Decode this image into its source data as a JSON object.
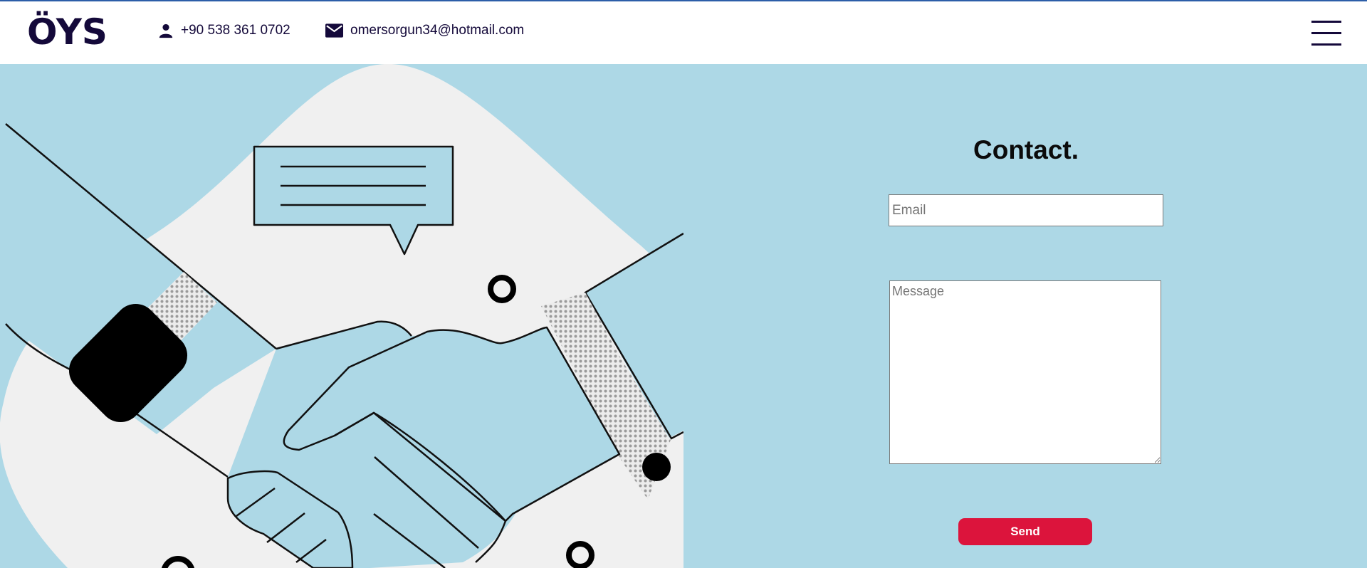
{
  "header": {
    "logo": "ÖYS",
    "phone": "+90 538 361 0702",
    "email": "omersorgun34@hotmail.com"
  },
  "contact": {
    "title": "Contact.",
    "email_placeholder": "Email",
    "message_placeholder": "Message",
    "send_label": "Send"
  },
  "colors": {
    "background": "#add8e6",
    "header_bg": "#ffffff",
    "brand_text": "#14093a",
    "send_button": "#dc143c"
  },
  "icons": [
    "person-icon",
    "mail-icon",
    "hamburger-menu-icon"
  ]
}
